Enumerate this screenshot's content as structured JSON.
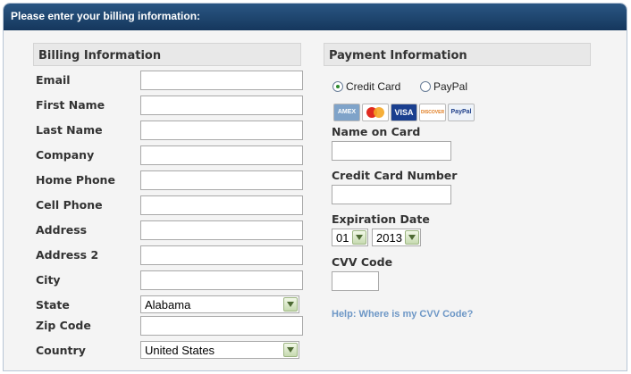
{
  "header": {
    "title": "Please enter your billing information:"
  },
  "billing": {
    "section_title": "Billing Information",
    "fields": {
      "email": {
        "label": "Email",
        "value": ""
      },
      "first_name": {
        "label": "First Name",
        "value": ""
      },
      "last_name": {
        "label": "Last Name",
        "value": ""
      },
      "company": {
        "label": "Company",
        "value": ""
      },
      "home_phone": {
        "label": "Home Phone",
        "value": ""
      },
      "cell_phone": {
        "label": "Cell Phone",
        "value": ""
      },
      "address": {
        "label": "Address",
        "value": ""
      },
      "address2": {
        "label": "Address 2",
        "value": ""
      },
      "city": {
        "label": "City",
        "value": ""
      },
      "state": {
        "label": "State",
        "value": "Alabama"
      },
      "zip": {
        "label": "Zip Code",
        "value": ""
      },
      "country": {
        "label": "Country",
        "value": "United States"
      }
    }
  },
  "payment": {
    "section_title": "Payment Information",
    "methods": {
      "credit_card": {
        "label": "Credit Card",
        "selected": true
      },
      "paypal": {
        "label": "PayPal",
        "selected": false
      }
    },
    "card_logos": [
      {
        "name": "amex",
        "text": "AMEX"
      },
      {
        "name": "mastercard",
        "text": ""
      },
      {
        "name": "visa",
        "text": "VISA"
      },
      {
        "name": "discover",
        "text": "DISCOVER"
      },
      {
        "name": "paypal",
        "text": "PayPal"
      }
    ],
    "name_on_card": {
      "label": "Name on Card",
      "value": ""
    },
    "card_number": {
      "label": "Credit Card Number",
      "value": ""
    },
    "expiration": {
      "label": "Expiration Date",
      "month": "01",
      "year": "2013"
    },
    "cvv": {
      "label": "CVV Code",
      "value": ""
    },
    "help_link": "Help: Where is my CVV Code?"
  },
  "colors": {
    "header_bg": "#1f4770",
    "help_link": "#6d97c6",
    "radio_dot": "#2d8a2d"
  }
}
